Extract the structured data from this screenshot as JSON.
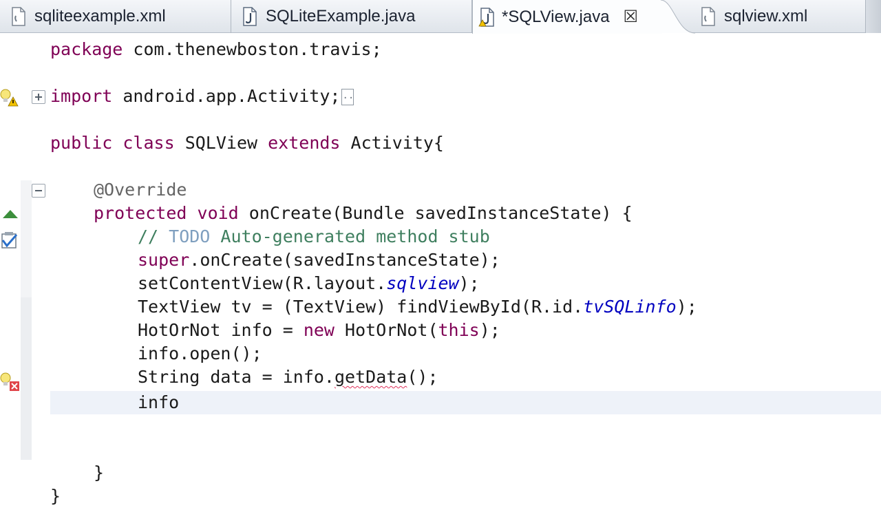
{
  "tabs": [
    {
      "label": "sqliteexample.xml",
      "type": "xml"
    },
    {
      "label": "SQLiteExample.java",
      "type": "java"
    },
    {
      "label": "*SQLView.java",
      "type": "java",
      "active": true,
      "close": "☒"
    },
    {
      "label": "sqlview.xml",
      "type": "xml"
    }
  ],
  "code": {
    "l1_kw": "package",
    "l1_rest": " com.thenewboston.travis;",
    "l2_kw": "import",
    "l2_rest": " android.app.Activity;",
    "l2_collapsed": "..",
    "l3_kw1": "public",
    "l3_kw2": "class",
    "l3_name": " SQLView ",
    "l3_kw3": "extends",
    "l3_rest": " Activity{",
    "l4_ann": "@Override",
    "l5_kw1": "protected",
    "l5_kw2": "void",
    "l5_rest": " onCreate(Bundle savedInstanceState) {",
    "l6_slashes": "// ",
    "l6_todo": "TODO",
    "l6_rest": " Auto-generated method stub",
    "l7_kw": "super",
    "l7_rest": ".onCreate(savedInstanceState);",
    "l8_pre": "setContentView(R.layout.",
    "l8_field": "sqlview",
    "l8_post": ");",
    "l9_pre": "TextView tv = (TextView) findViewById(R.id.",
    "l9_field": "tvSQLinfo",
    "l9_post": ");",
    "l10_pre": "HotOrNot info = ",
    "l10_kw1": "new",
    "l10_mid": " HotOrNot(",
    "l10_kw2": "this",
    "l10_post": ");",
    "l11": "info.open();",
    "l12_pre": "String data = info.",
    "l12_err": "getData",
    "l12_post": "();",
    "l13": "info",
    "l14": "}",
    "l15": "}"
  }
}
